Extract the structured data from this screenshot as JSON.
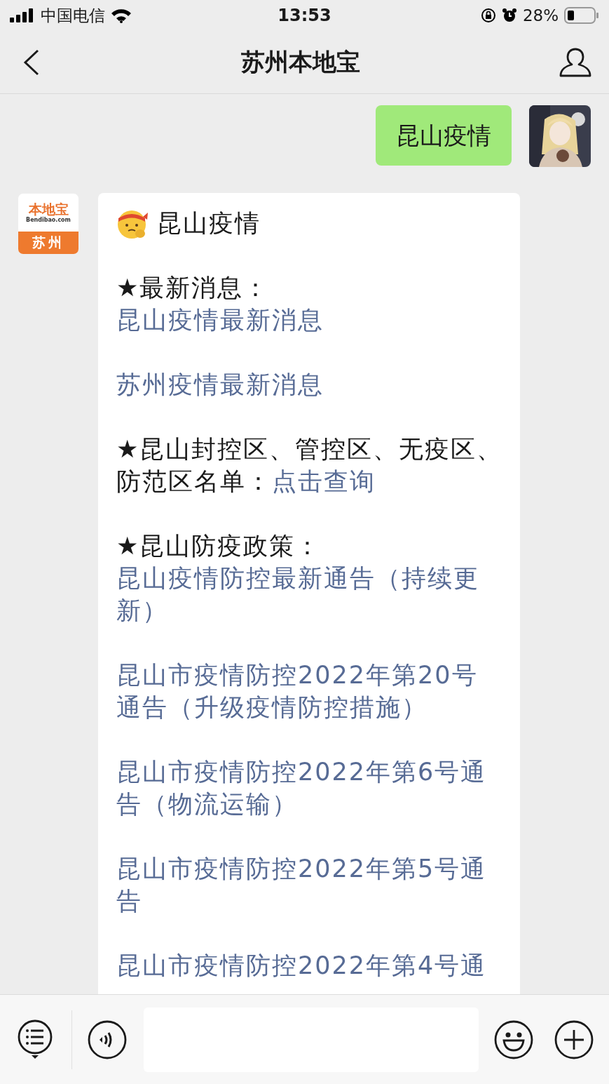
{
  "status_bar": {
    "carrier": "中国电信",
    "time": "13:53",
    "battery": "28%"
  },
  "header": {
    "title": "苏州本地宝"
  },
  "messages": [
    {
      "kind": "outgoing",
      "text": "昆山疫情"
    },
    {
      "kind": "incoming",
      "avatar": {
        "brand": "本地宝",
        "site": "Bendibao.com",
        "city": "苏州"
      },
      "title": "昆山疫情",
      "groups": [
        [
          {
            "kind": "heading",
            "text": "★最新消息："
          },
          {
            "kind": "link",
            "text": "昆山疫情最新消息"
          }
        ],
        [
          {
            "kind": "link",
            "text": "苏州疫情最新消息"
          }
        ],
        [
          {
            "kind": "mixed",
            "text": "★昆山封控区、管控区、无疫区、防范区名单：",
            "link": "点击查询"
          }
        ],
        [
          {
            "kind": "heading",
            "text": "★昆山防疫政策："
          },
          {
            "kind": "link",
            "text": "昆山疫情防控最新通告（持续更新）"
          }
        ],
        [
          {
            "kind": "link",
            "text": "昆山市疫情防控2022年第20号通告（升级疫情防控措施）"
          }
        ],
        [
          {
            "kind": "link",
            "text": "昆山市疫情防控2022年第6号通告（物流运输）"
          }
        ],
        [
          {
            "kind": "link",
            "text": "昆山市疫情防控2022年第5号通告"
          }
        ],
        [
          {
            "kind": "link",
            "text": "昆山市疫情防控2022年第4号通"
          }
        ]
      ]
    }
  ]
}
